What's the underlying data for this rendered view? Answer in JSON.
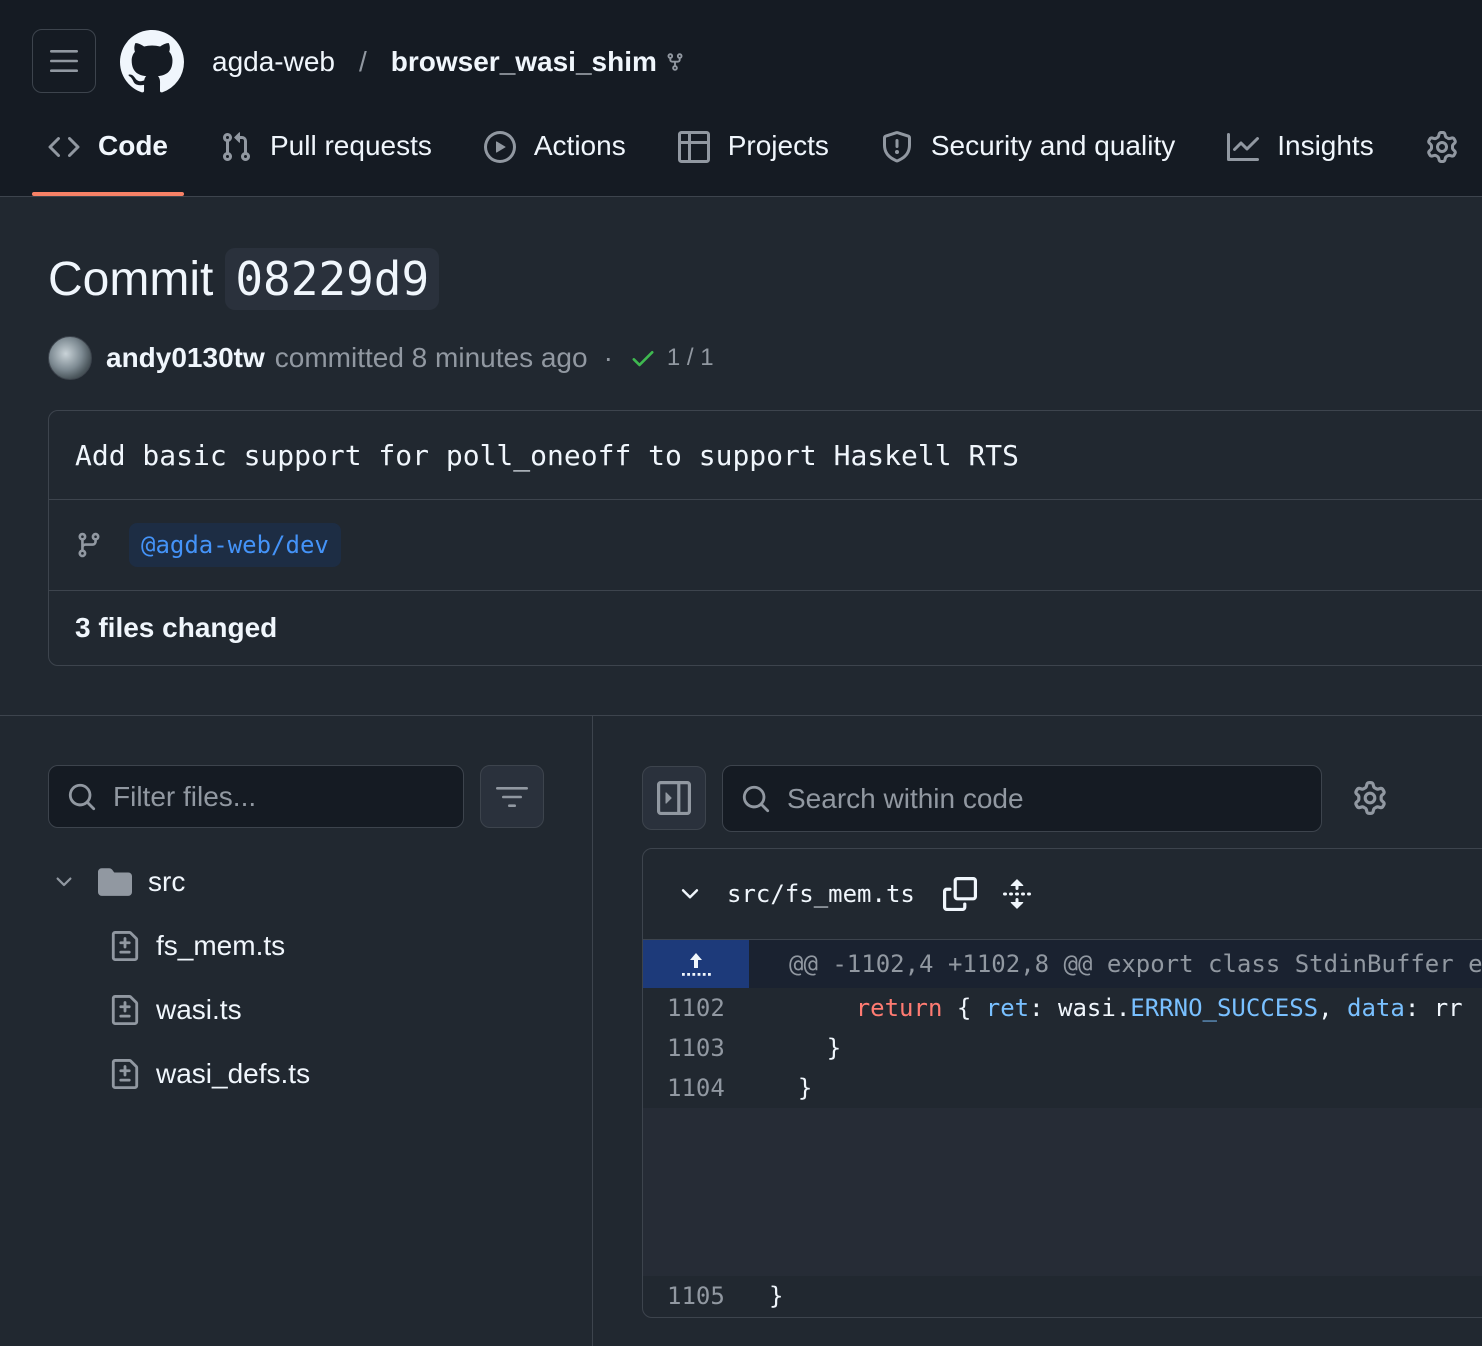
{
  "header": {
    "owner": "agda-web",
    "separator": "/",
    "repo": "browser_wasi_shim",
    "tabs": [
      {
        "label": "Code",
        "icon": "code-icon",
        "active": true
      },
      {
        "label": "Pull requests",
        "icon": "git-pull-request-icon",
        "active": false
      },
      {
        "label": "Actions",
        "icon": "play-icon",
        "active": false
      },
      {
        "label": "Projects",
        "icon": "table-icon",
        "active": false
      },
      {
        "label": "Security and quality",
        "icon": "shield-icon",
        "active": false
      },
      {
        "label": "Insights",
        "icon": "graph-icon",
        "active": false
      }
    ]
  },
  "commit": {
    "title_prefix": "Commit",
    "hash": "08229d9",
    "author": "andy0130tw",
    "committed_text": "committed 8 minutes ago",
    "dot": "·",
    "checks": "1 / 1",
    "message": "Add basic support for poll_oneoff to support Haskell RTS",
    "branch": "@agda-web/dev",
    "files_changed": "3 files changed"
  },
  "file_tree": {
    "filter_placeholder": "Filter files...",
    "folder": "src",
    "files": [
      "fs_mem.ts",
      "wasi.ts",
      "wasi_defs.ts"
    ]
  },
  "diff": {
    "search_placeholder": "Search within code",
    "path": "src/fs_mem.ts",
    "hunk_header": "@@ -1102,4 +1102,8 @@ export class StdinBuffer e",
    "lines": [
      {
        "num": "1102",
        "indent": "      ",
        "kw": "return",
        "t1": " { ",
        "p1": "ret",
        "t2": ": wasi.",
        "c1": "ERRNO_SUCCESS",
        "t3": ", ",
        "p2": "data",
        "t4": ": rr"
      },
      {
        "num": "1103",
        "text": "    }"
      },
      {
        "num": "1104",
        "text": "  }"
      },
      {
        "num": "1105",
        "text": "}"
      }
    ]
  },
  "colors": {
    "accent_underline": "#f78166",
    "link": "#4493f8",
    "success": "#3fb950",
    "keyword": "#ff7b72",
    "property": "#79c0ff"
  }
}
